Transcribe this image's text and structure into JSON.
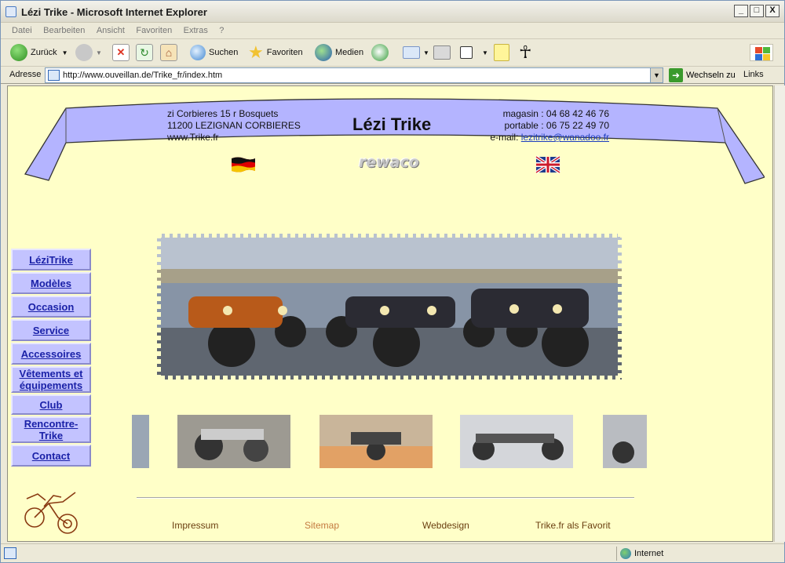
{
  "window": {
    "title": "Lézi Trike - Microsoft Internet Explorer",
    "buttons": [
      "_",
      "□",
      "X"
    ]
  },
  "menu": [
    "Datei",
    "Bearbeiten",
    "Ansicht",
    "Favoriten",
    "Extras",
    "?"
  ],
  "toolbar": {
    "back": "Zurück",
    "search": "Suchen",
    "favorites": "Favoriten",
    "media": "Medien"
  },
  "addressbar": {
    "label": "Adresse",
    "url": "http://www.ouveillan.de/Trike_fr/index.htm",
    "go": "Wechseln zu",
    "links": "Links"
  },
  "page": {
    "address": [
      "zi Corbieres 15 r Bosquets",
      "11200 LEZIGNAN CORBIERES",
      "www.Trike.fr"
    ],
    "brand": "Lézi Trike",
    "phone_shop": "magasin : 04 68 42 46 76",
    "phone_mobile": "portable : 06 75 22 49 70",
    "email_label": "e-mail:",
    "email": "lezitrike@wanadoo.fr",
    "partner_logo": "rewaco",
    "nav": [
      "LéziTrike",
      "Modèles",
      "Occasion",
      "Service",
      "Accessoires",
      "Vêtements et équipements",
      "Club",
      "Rencontre-Trike",
      "Contact"
    ],
    "footer": [
      "Impressum",
      "Sitemap",
      "Webdesign",
      "Trike.fr als Favorit"
    ]
  },
  "status": {
    "zone": "Internet"
  },
  "colors": {
    "page_bg": "#ffffc8",
    "banner": "#b4b4ff",
    "nav_bg": "#c3c3ff",
    "nav_text": "#1a21a7",
    "footer_text": "#6a3e10"
  }
}
